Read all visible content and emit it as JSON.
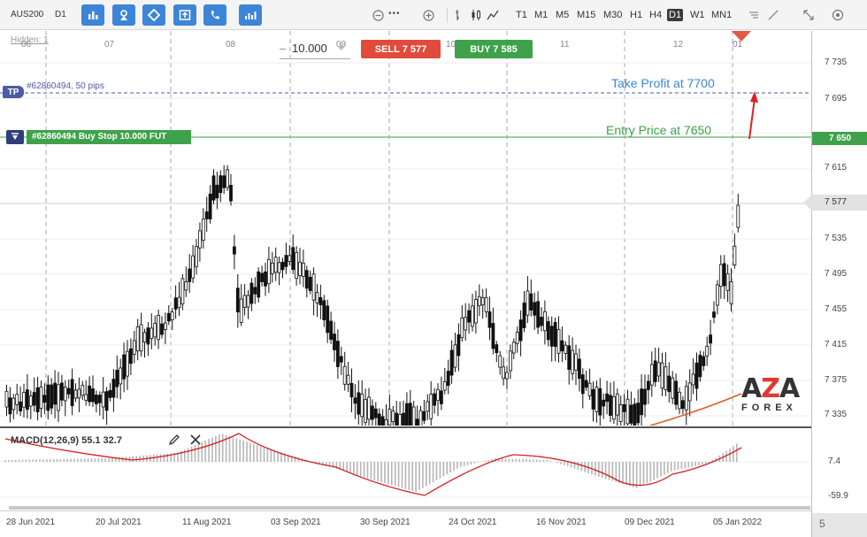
{
  "toolbar": {
    "symbol": "AUS200",
    "period": "D1",
    "tool_buttons": [
      "bar-chart-icon",
      "cursor-icon",
      "diamond-icon",
      "export-icon",
      "phone-icon",
      "indicators-icon"
    ],
    "timeframes": [
      "T1",
      "M1",
      "M5",
      "M15",
      "M30",
      "H1",
      "H4",
      "D1",
      "W1",
      "MN1"
    ],
    "active_timeframe": "D1",
    "zoom_out_icon": "minus-icon",
    "zoom_in_icon": "plus-icon",
    "dots": "•••"
  },
  "chart": {
    "hidden_label": "Hidden: 1",
    "lot_value": "10.000",
    "sell_label": "SELL 7 577",
    "buy_label": "BUY 7 585",
    "sell_color": "#e04b3c",
    "buy_color": "#3fa24a",
    "top_date_labels": [
      "06",
      "07",
      "08",
      "09",
      "10",
      "11",
      "12",
      "01"
    ],
    "tp_badge": "TP",
    "tp_label": "#62860494, 50 pips",
    "entry_label": "#62860494 Buy Stop 10.000 FUT",
    "take_profit_text": "Take Profit at 7700",
    "entry_text": "Entry Price at 7650",
    "tp_color": "#3d85d8",
    "entry_color": "#3fa24a",
    "current_price": "7 577",
    "entry_price": "7 650"
  },
  "price_axis": {
    "labels": [
      "7 735",
      "7 695",
      "7 615",
      "7 535",
      "7 495",
      "7 455",
      "7 415",
      "7 375",
      "7 335"
    ]
  },
  "macd": {
    "label": "MACD(12,26,9) 55.1 32.7",
    "axis_labels": [
      "7.4",
      "-59.9"
    ]
  },
  "date_axis": {
    "labels": [
      "28 Jun 2021",
      "20 Jul 2021",
      "11 Aug 2021",
      "03 Sep 2021",
      "30 Sep 2021",
      "24 Oct 2021",
      "16 Nov 2021",
      "09 Dec 2021",
      "05 Jan 2022"
    ]
  },
  "footer": {
    "page_value": "5"
  },
  "logo": {
    "brand": "AZA",
    "sub": "FOREX"
  }
}
